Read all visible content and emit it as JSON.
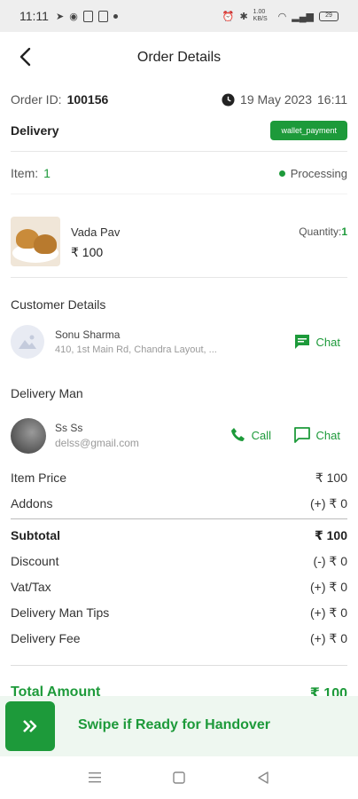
{
  "status_bar": {
    "time": "11:11",
    "network_speed": "1.00 KB/S",
    "battery": "29"
  },
  "header": {
    "title": "Order Details"
  },
  "order": {
    "id_label": "Order ID:",
    "id_value": "100156",
    "date": "19 May 2023",
    "time": "16:11",
    "type": "Delivery",
    "payment_badge": "wallet_payment",
    "item_label": "Item:",
    "item_count": "1",
    "status": "Processing"
  },
  "product": {
    "name": "Vada Pav",
    "price": "₹ 100",
    "quantity_label": "Quantity:",
    "quantity_value": "1"
  },
  "customer": {
    "section_title": "Customer Details",
    "name": "Sonu Sharma",
    "address": "410, 1st Main Rd, Chandra Layout, ...",
    "chat_label": "Chat"
  },
  "delivery_man": {
    "section_title": "Delivery Man",
    "name": "Ss Ss",
    "email": "delss@gmail.com",
    "call_label": "Call",
    "chat_label": "Chat"
  },
  "pricing": {
    "item_price_label": "Item Price",
    "item_price_value": "₹ 100",
    "addons_label": "Addons",
    "addons_value": "(+) ₹ 0",
    "subtotal_label": "Subtotal",
    "subtotal_value": "₹ 100",
    "discount_label": "Discount",
    "discount_value": "(-) ₹ 0",
    "vat_label": "Vat/Tax",
    "vat_value": "(+) ₹ 0",
    "tips_label": "Delivery Man Tips",
    "tips_value": "(+) ₹ 0",
    "fee_label": "Delivery Fee",
    "fee_value": "(+) ₹ 0",
    "total_label": "Total Amount",
    "total_value": "₹ 100"
  },
  "swipe": {
    "label": "Swipe if Ready for Handover"
  },
  "colors": {
    "accent": "#1d9a3a"
  },
  "icons": [
    "back-arrow-icon",
    "clock-icon",
    "chat-icon",
    "phone-icon",
    "double-chevron-right-icon",
    "image-placeholder-icon"
  ]
}
